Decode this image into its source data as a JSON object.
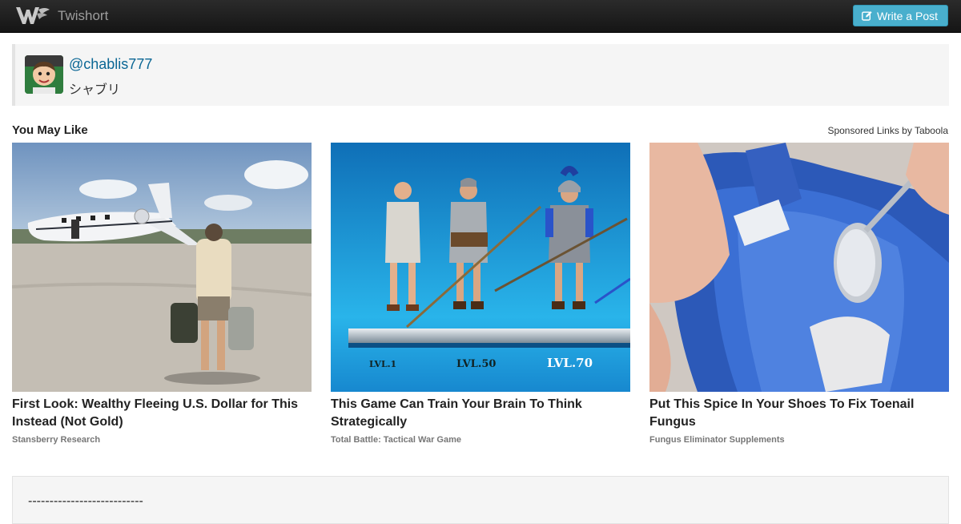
{
  "navbar": {
    "brand_name": "Twishort",
    "brand_icon": "twishort-logo",
    "write_label": "Write a Post",
    "write_icon": "edit-icon",
    "accent": "#49afcd"
  },
  "profile": {
    "handle": "@chablis777",
    "display_name": "シャブリ"
  },
  "recommendations": {
    "title": "You May Like",
    "sponsored": "Sponsored Links by Taboola",
    "items": [
      {
        "headline": "First Look: Wealthy Fleeing U.S. Dollar for This Instead (Not Gold)",
        "source": "Stansberry Research"
      },
      {
        "headline": "This Game Can Train Your Brain To Think Strategically",
        "source": "Total Battle: Tactical War Game",
        "image_labels": [
          "LVL.1",
          "LVL.50",
          "LVL.70"
        ]
      },
      {
        "headline": "Put This Spice In Your Shoes To Fix Toenail Fungus",
        "source": "Fungus Eliminator Supplements"
      }
    ]
  },
  "post": {
    "text": "---------------------------"
  }
}
